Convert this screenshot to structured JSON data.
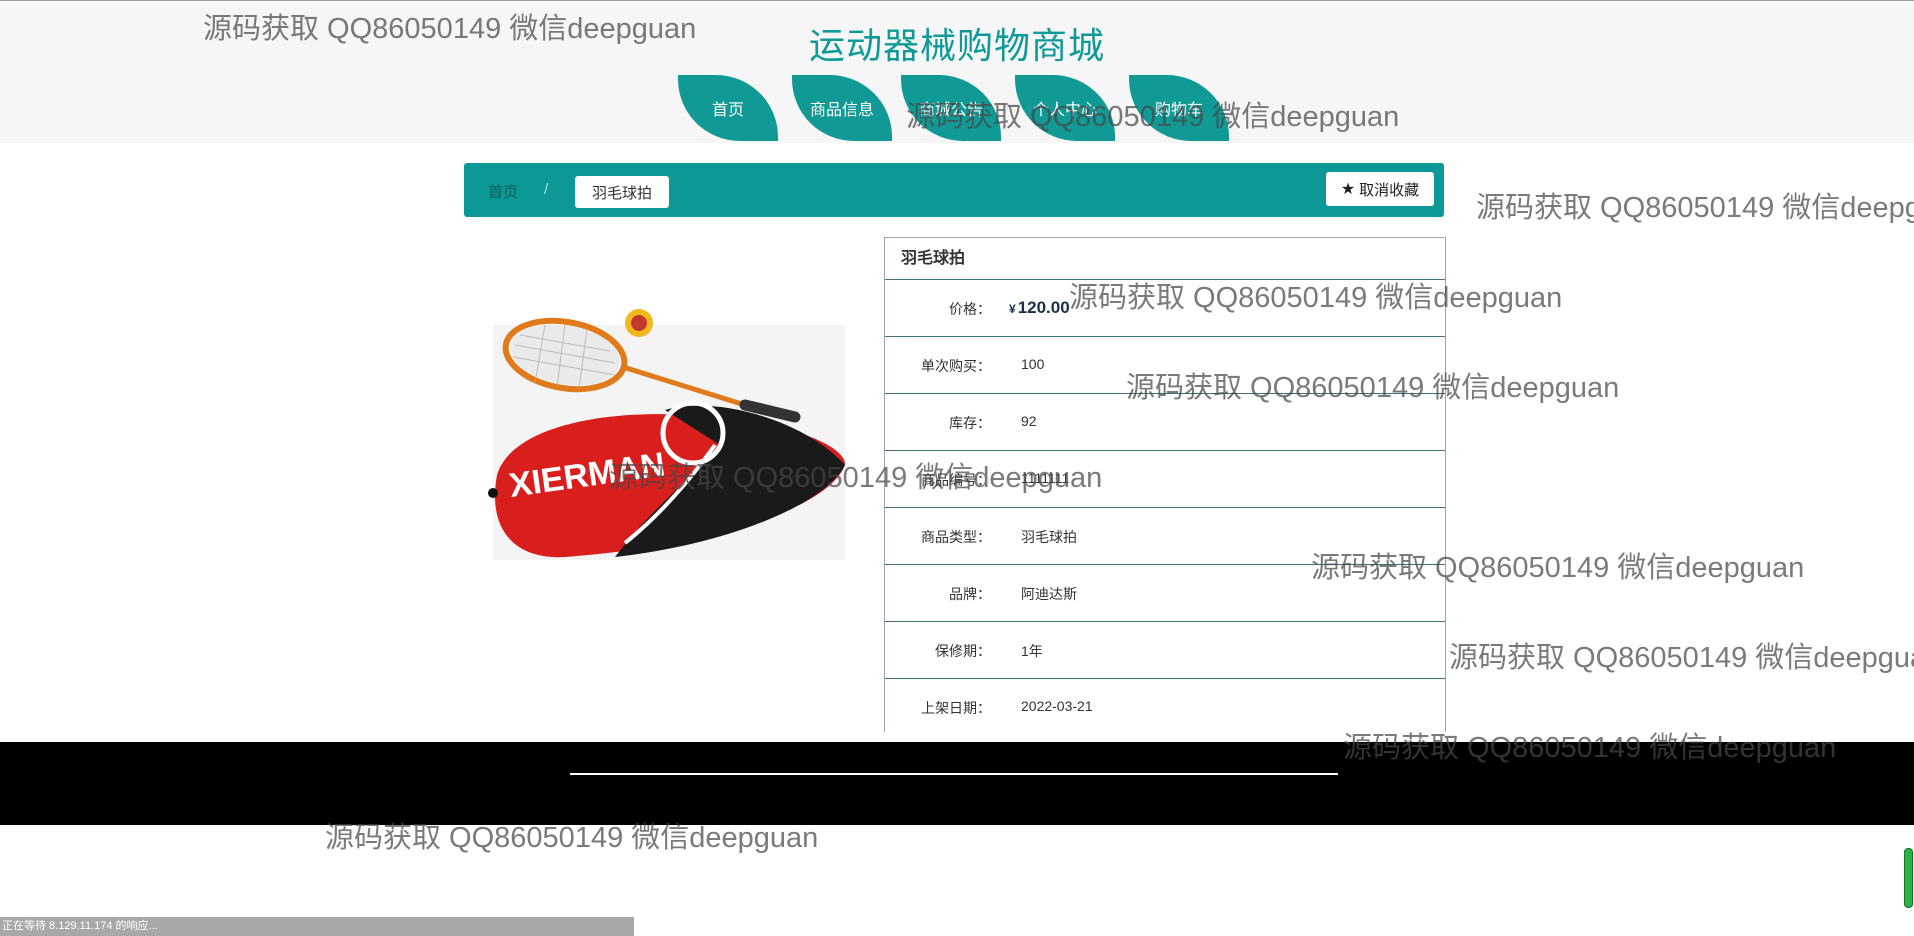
{
  "header": {
    "site_title": "运动器械购物商城",
    "nav": [
      "首页",
      "商品信息",
      "商城公告",
      "个人中心",
      "购物车"
    ]
  },
  "breadcrumb": {
    "home": "首页",
    "separator": "/",
    "current": "羽毛球拍",
    "favorite_icon": "star-icon",
    "favorite_label": "取消收藏"
  },
  "product": {
    "name": "羽毛球拍",
    "image_alt": "badminton racket with red bag",
    "price_currency": "¥",
    "price_value": "120.00",
    "rows": [
      {
        "label": "价格：",
        "value": "120.00"
      },
      {
        "label": "单次购买：",
        "value": "100"
      },
      {
        "label": "库存：",
        "value": "92"
      },
      {
        "label": "商品编号：",
        "value": "1111111"
      },
      {
        "label": "商品类型：",
        "value": "羽毛球拍"
      },
      {
        "label": "品牌：",
        "value": "阿迪达斯"
      },
      {
        "label": "保修期：",
        "value": "1年"
      },
      {
        "label": "上架日期：",
        "value": "2022-03-21"
      }
    ]
  },
  "status_bar": "正在等待 8.129.11.174 的响应...",
  "watermark": "源码获取 QQ86050149 微信deepguan",
  "colors": {
    "accent": "#0b9896",
    "header_bg": "#f6f6f6"
  }
}
